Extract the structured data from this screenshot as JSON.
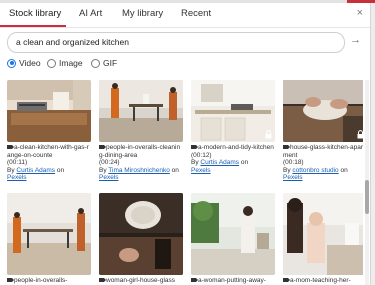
{
  "tabs": [
    {
      "label": "Stock library",
      "active": true
    },
    {
      "label": "AI Art",
      "active": false
    },
    {
      "label": "My library",
      "active": false
    },
    {
      "label": "Recent",
      "active": false
    }
  ],
  "close_symbol": "×",
  "search": {
    "value": "a clean and organized kitchen",
    "go_symbol": "→"
  },
  "media_types": [
    {
      "label": "Video",
      "checked": true
    },
    {
      "label": "Image",
      "checked": false
    },
    {
      "label": "GIF",
      "checked": false
    }
  ],
  "colors": {
    "accent": "#c8303b",
    "link": "#1a5fb4",
    "radio": "#1a73e8"
  },
  "results": [
    {
      "file": "a-clean-kitchen-with-gas-range-on-counte",
      "duration": "(00:11)",
      "by": "By",
      "author": "Curtis Adams",
      "on": "on",
      "source": "Pexels",
      "locked": false
    },
    {
      "file": "people-in-overalls-cleaning-dining-area",
      "duration": "(00:24)",
      "by": "By",
      "author": "Tima Miroshnichenko",
      "on": "on",
      "source": "Pexels",
      "locked": false
    },
    {
      "file": "a-modern-and-tidy-kitchen",
      "duration": "(00:12)",
      "by": "By",
      "author": "Curtis Adams",
      "on": "on",
      "source": "Pexels",
      "locked": true
    },
    {
      "file": "house-glass-kitchen-apartment",
      "duration": "(00:18)",
      "by": "By",
      "author": "cottonbro studio",
      "on": "on",
      "source": "Pexels",
      "locked": true
    },
    {
      "file": "people-in-overalls-",
      "duration": "",
      "by": "",
      "author": "",
      "on": "",
      "source": "",
      "locked": false
    },
    {
      "file": "woman-girl-house-glass",
      "duration": "",
      "by": "",
      "author": "",
      "on": "",
      "source": "",
      "locked": false
    },
    {
      "file": "a-woman-putting-away-",
      "duration": "",
      "by": "",
      "author": "",
      "on": "",
      "source": "",
      "locked": false
    },
    {
      "file": "a-mom-teaching-her-",
      "duration": "",
      "by": "",
      "author": "",
      "on": "",
      "source": "",
      "locked": false
    }
  ]
}
